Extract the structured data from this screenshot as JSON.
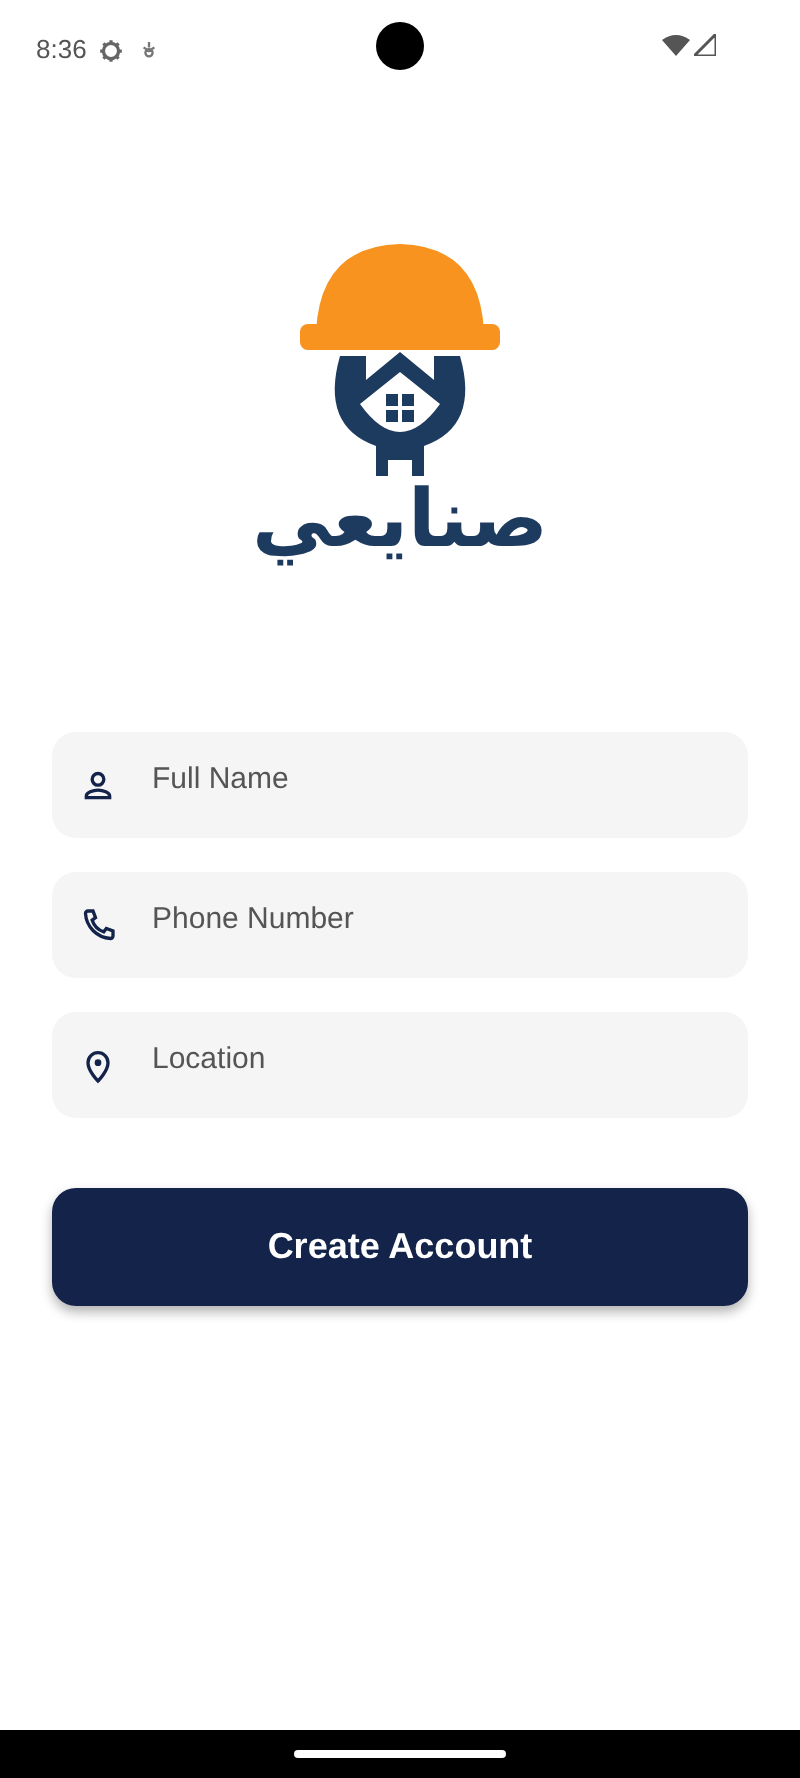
{
  "status_bar": {
    "time": "8:36"
  },
  "logo": {
    "text": "صنايعي"
  },
  "fields": [
    {
      "kind": "person",
      "placeholder": "Full Name"
    },
    {
      "kind": "phone",
      "placeholder": "Phone Number"
    },
    {
      "kind": "location",
      "placeholder": "Location"
    }
  ],
  "button": {
    "label": "Create Account"
  }
}
